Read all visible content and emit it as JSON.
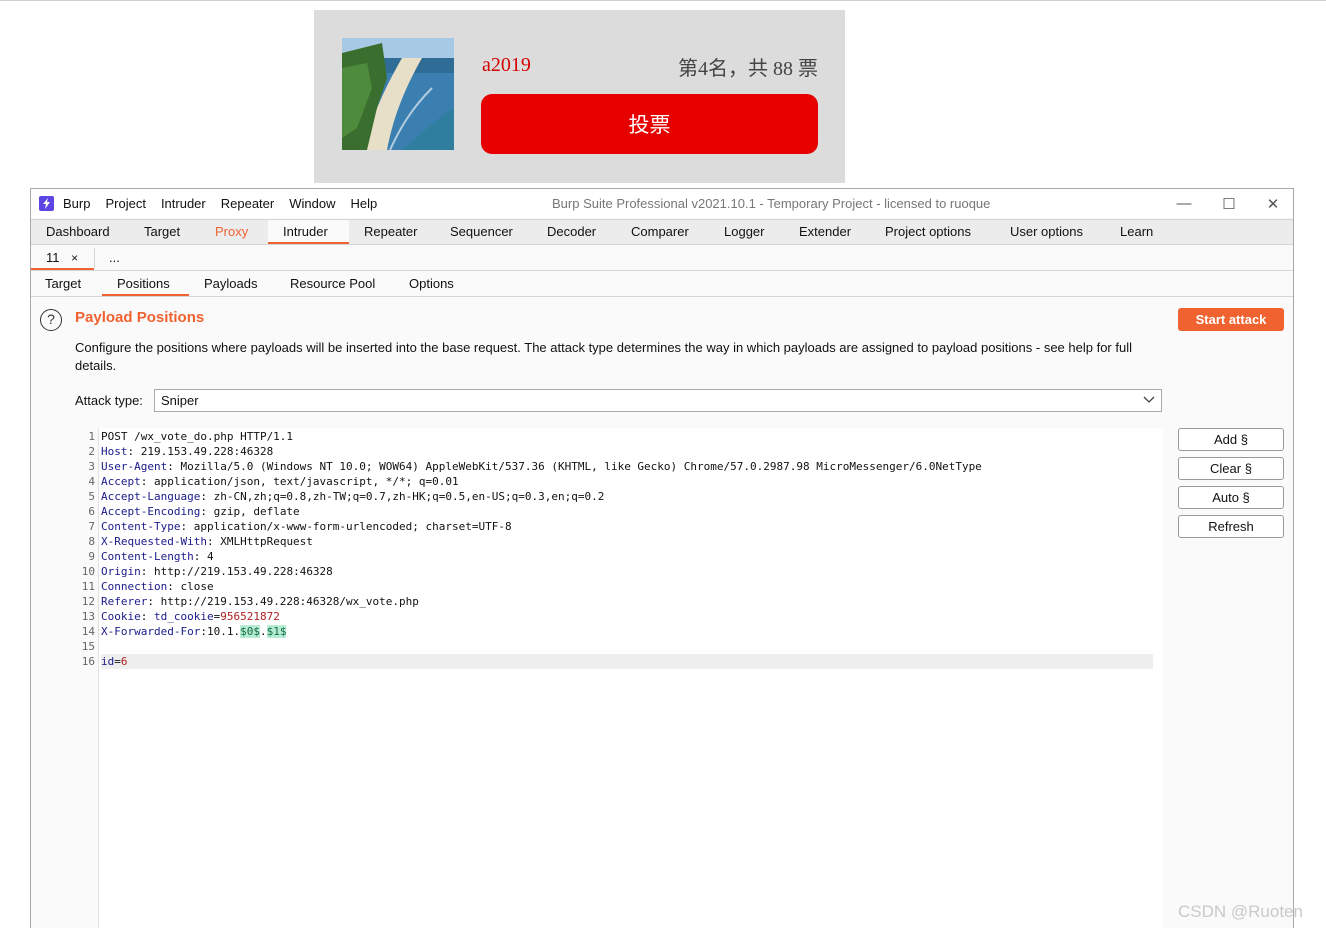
{
  "vote_card": {
    "name": "a2019",
    "rank_text": "第4名，共 88 票",
    "vote_button": "投票"
  },
  "burp": {
    "menu": [
      "Burp",
      "Project",
      "Intruder",
      "Repeater",
      "Window",
      "Help"
    ],
    "window_title": "Burp Suite Professional v2021.10.1 - Temporary Project - licensed to ruoque",
    "window_controls": {
      "minimize": "—",
      "maximize": "☐",
      "close": "✕"
    },
    "main_tabs": [
      "Dashboard",
      "Target",
      "Proxy",
      "Intruder",
      "Repeater",
      "Sequencer",
      "Decoder",
      "Comparer",
      "Logger",
      "Extender",
      "Project options",
      "User options",
      "Learn"
    ],
    "active_main_tab": "Intruder",
    "instance_tabs": {
      "active": "11",
      "close": "×",
      "more": "..."
    },
    "sub_tabs": [
      "Target",
      "Positions",
      "Payloads",
      "Resource Pool",
      "Options"
    ],
    "active_sub_tab": "Positions",
    "help_icon": "?",
    "section_title": "Payload Positions",
    "description": "Configure the positions where payloads will be inserted into the base request. The attack type determines the way in which payloads are assigned to payload positions - see help for full details.",
    "start_attack": "Start attack",
    "attack_type_label": "Attack type:",
    "attack_type_value": "Sniper",
    "side_buttons": {
      "add": "Add §",
      "clear": "Clear §",
      "auto": "Auto §",
      "refresh": "Refresh"
    },
    "line_numbers": [
      "1",
      "2",
      "3",
      "4",
      "5",
      "6",
      "7",
      "8",
      "9",
      "10",
      "11",
      "12",
      "13",
      "14",
      "15",
      "16"
    ],
    "request": {
      "l1": "POST /wx_vote_do.php HTTP/1.1",
      "l2_k": "Host",
      "l2_v": ": 219.153.49.228:46328",
      "l3_k": "User-Agent",
      "l3_v": ": Mozilla/5.0 (Windows NT 10.0; WOW64) AppleWebKit/537.36 (KHTML, like Gecko) Chrome/57.0.2987.98 MicroMessenger/6.0NetType",
      "l4_k": "Accept",
      "l4_v": ": application/json, text/javascript, */*; q=0.01",
      "l5_k": "Accept-Language",
      "l5_v": ": zh-CN,zh;q=0.8,zh-TW;q=0.7,zh-HK;q=0.5,en-US;q=0.3,en;q=0.2",
      "l6_k": "Accept-Encoding",
      "l6_v": ": gzip, deflate",
      "l7_k": "Content-Type",
      "l7_v": ": application/x-www-form-urlencoded; charset=UTF-8",
      "l8_k": "X-Requested-With",
      "l8_v": ": XMLHttpRequest",
      "l9_k": "Content-Length",
      "l9_v": ": 4",
      "l10_k": "Origin",
      "l10_v": ": http://219.153.49.228:46328",
      "l11_k": "Connection",
      "l11_v": ": close",
      "l12_k": "Referer",
      "l12_v": ": http://219.153.49.228:46328/wx_vote.php",
      "l13_k": "Cookie",
      "l13_sep": ": ",
      "l13_name": "td_cookie",
      "l13_eq": "=",
      "l13_val": "956521872",
      "l14_k": "X-Forwarded-For",
      "l14_v": ":10.1.",
      "l14_m1": "$0$",
      "l14_dot": ".",
      "l14_m2": "$1$",
      "l16_k": "id",
      "l16_eq": "=",
      "l16_v": "6"
    }
  },
  "watermark": "CSDN @Ruoten"
}
